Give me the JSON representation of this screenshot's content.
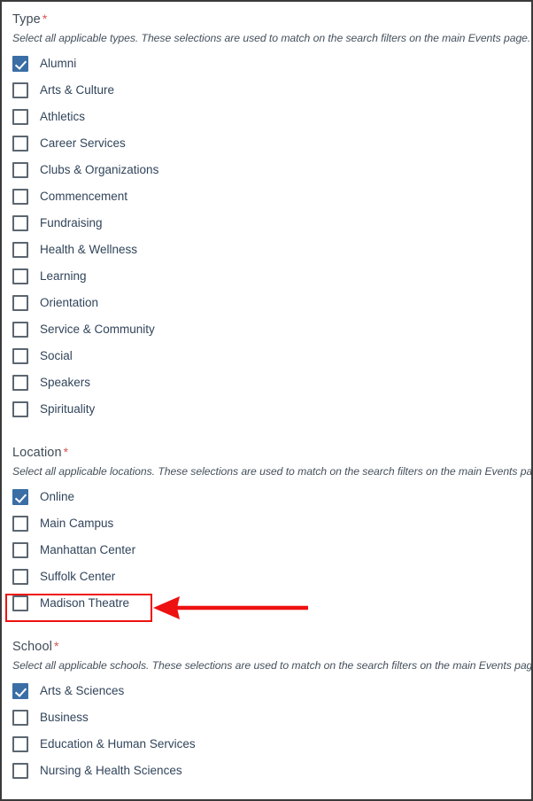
{
  "form": {
    "groups": [
      {
        "key": "type",
        "heading": "Type",
        "required_marker": "*",
        "help": "Select all applicable types. These selections are used to match on the search filters on the main Events page.",
        "options": [
          {
            "label": "Alumni",
            "checked": true
          },
          {
            "label": "Arts & Culture",
            "checked": false
          },
          {
            "label": "Athletics",
            "checked": false
          },
          {
            "label": "Career Services",
            "checked": false
          },
          {
            "label": "Clubs & Organizations",
            "checked": false
          },
          {
            "label": "Commencement",
            "checked": false
          },
          {
            "label": "Fundraising",
            "checked": false
          },
          {
            "label": "Health & Wellness",
            "checked": false
          },
          {
            "label": "Learning",
            "checked": false
          },
          {
            "label": "Orientation",
            "checked": false
          },
          {
            "label": "Service & Community",
            "checked": false
          },
          {
            "label": "Social",
            "checked": false
          },
          {
            "label": "Speakers",
            "checked": false
          },
          {
            "label": "Spirituality",
            "checked": false
          }
        ]
      },
      {
        "key": "location",
        "heading": "Location",
        "required_marker": "*",
        "help": "Select all applicable locations. These selections are used to match on the search filters on the main Events page.",
        "options": [
          {
            "label": "Online",
            "checked": true
          },
          {
            "label": "Main Campus",
            "checked": false
          },
          {
            "label": "Manhattan Center",
            "checked": false
          },
          {
            "label": "Suffolk Center",
            "checked": false
          },
          {
            "label": "Madison Theatre",
            "checked": false
          }
        ]
      },
      {
        "key": "school",
        "heading": "School",
        "required_marker": "*",
        "help": "Select all applicable schools. These selections are used to match on the search filters on the main Events page.",
        "options": [
          {
            "label": "Arts & Sciences",
            "checked": true
          },
          {
            "label": "Business",
            "checked": false
          },
          {
            "label": "Education & Human Services",
            "checked": false
          },
          {
            "label": "Nursing & Health Sciences",
            "checked": false
          }
        ]
      }
    ]
  },
  "annotation": {
    "highlight_target": "Madison Theatre",
    "color": "#ee1111",
    "arrow_direction": "left"
  },
  "colors": {
    "checkbox_checked": "#3a6ea5",
    "checkbox_border": "#5b6670",
    "label_text": "#31445a",
    "heading_text": "#3f4b57",
    "required_star": "#d9534f",
    "annotation_red": "#ee1111",
    "page_border": "#3a3a3a"
  }
}
